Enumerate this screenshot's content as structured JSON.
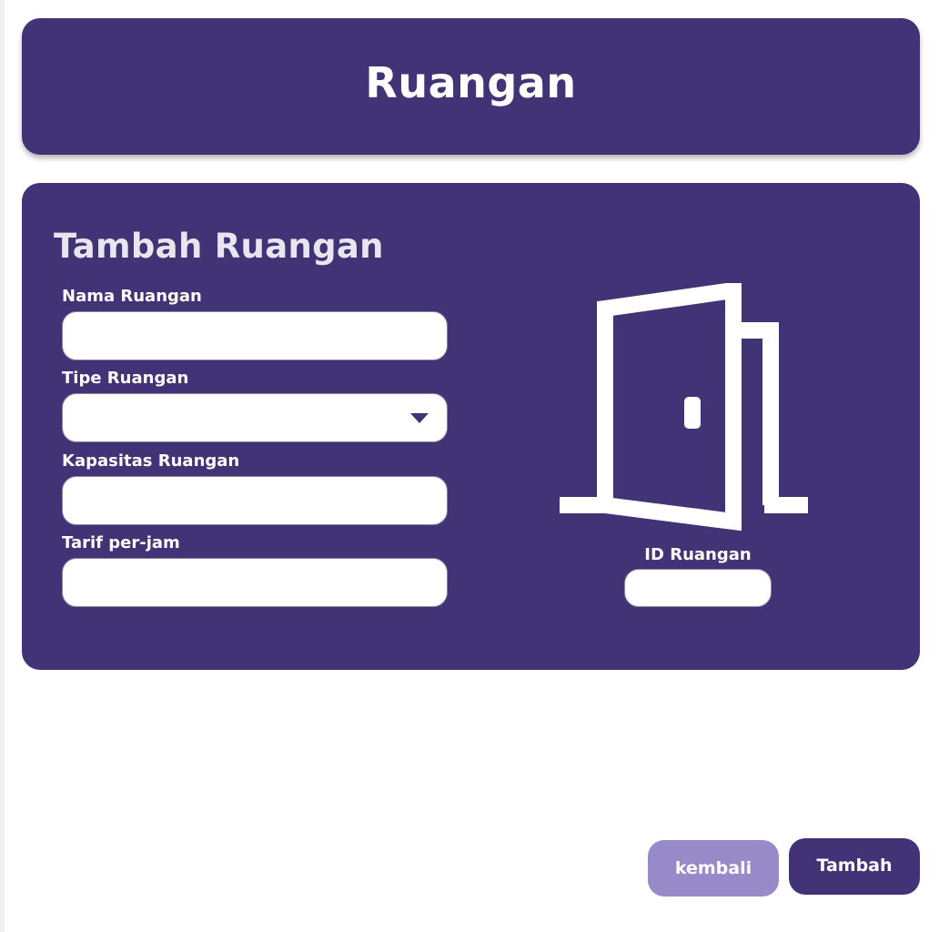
{
  "header": {
    "title": "Ruangan"
  },
  "form": {
    "title": "Tambah Ruangan",
    "fields": {
      "nama": {
        "label": "Nama Ruangan",
        "value": "",
        "placeholder": ""
      },
      "tipe": {
        "label": "Tipe Ruangan",
        "value": ""
      },
      "kapasitas": {
        "label": "Kapasitas Ruangan",
        "value": "",
        "placeholder": ""
      },
      "tarif": {
        "label": "Tarif per-jam",
        "value": "",
        "placeholder": ""
      }
    },
    "id_field": {
      "label": "ID Ruangan",
      "value": "",
      "placeholder": ""
    },
    "illustration_icon": "door-icon"
  },
  "actions": {
    "back_label": "kembali",
    "add_label": "Tambah"
  },
  "colors": {
    "primary": "#423276",
    "secondary": "#9889c9",
    "background": "#ffffff"
  }
}
